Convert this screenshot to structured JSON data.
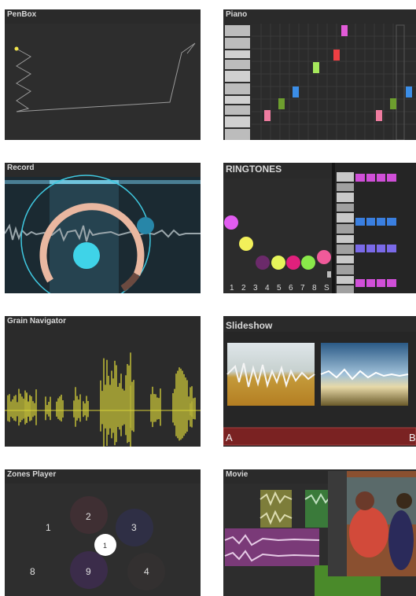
{
  "panels": {
    "penbox": {
      "title": "PenBox"
    },
    "piano": {
      "title": "Piano"
    },
    "record": {
      "title": "Record"
    },
    "ringtones": {
      "title": "RINGTONES",
      "numbers": [
        "1",
        "2",
        "3",
        "4",
        "5",
        "6",
        "7",
        "8",
        "S"
      ]
    },
    "grain": {
      "title": "Grain Navigator"
    },
    "slideshow": {
      "title": "Slideshow",
      "label_a": "A",
      "label_b": "B"
    },
    "zones": {
      "title": "Zones Player",
      "zones": [
        "1",
        "2",
        "3",
        "8",
        "9",
        "4"
      ],
      "cursor": "1"
    },
    "movie": {
      "title": "Movie"
    }
  },
  "colors": {
    "panel_bg": "#2a2a2a",
    "grain_yellow": "#d8d23a",
    "record_cyan": "#3fd3e8",
    "record_ring": "#e9b7a0",
    "slideshow_bar": "#7a2222"
  }
}
